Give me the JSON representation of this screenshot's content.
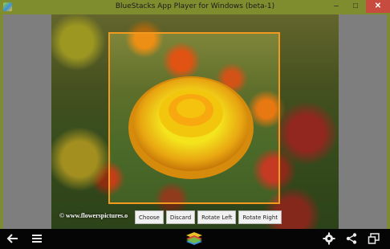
{
  "window": {
    "title": "BlueStacks App Player for Windows (beta-1)",
    "minimize_glyph": "–",
    "maximize_glyph": "□",
    "close_glyph": "✕"
  },
  "photo": {
    "watermark": "© www.flowerspictures.o"
  },
  "crop_actions": [
    "Choose",
    "Discard",
    "Rotate Left",
    "Rotate Right"
  ],
  "taskbar": {
    "left_icons": [
      "back-arrow-icon",
      "menu-icon"
    ],
    "center_icon": "bluestacks-logo-icon",
    "right_icons": [
      "gear-icon",
      "share-icon",
      "screen-icon"
    ]
  },
  "colors": {
    "titlebar": "#7f8d2f",
    "close_button": "#c74c3f",
    "crop_border": "#f29a1f",
    "taskbar": "#050505"
  }
}
